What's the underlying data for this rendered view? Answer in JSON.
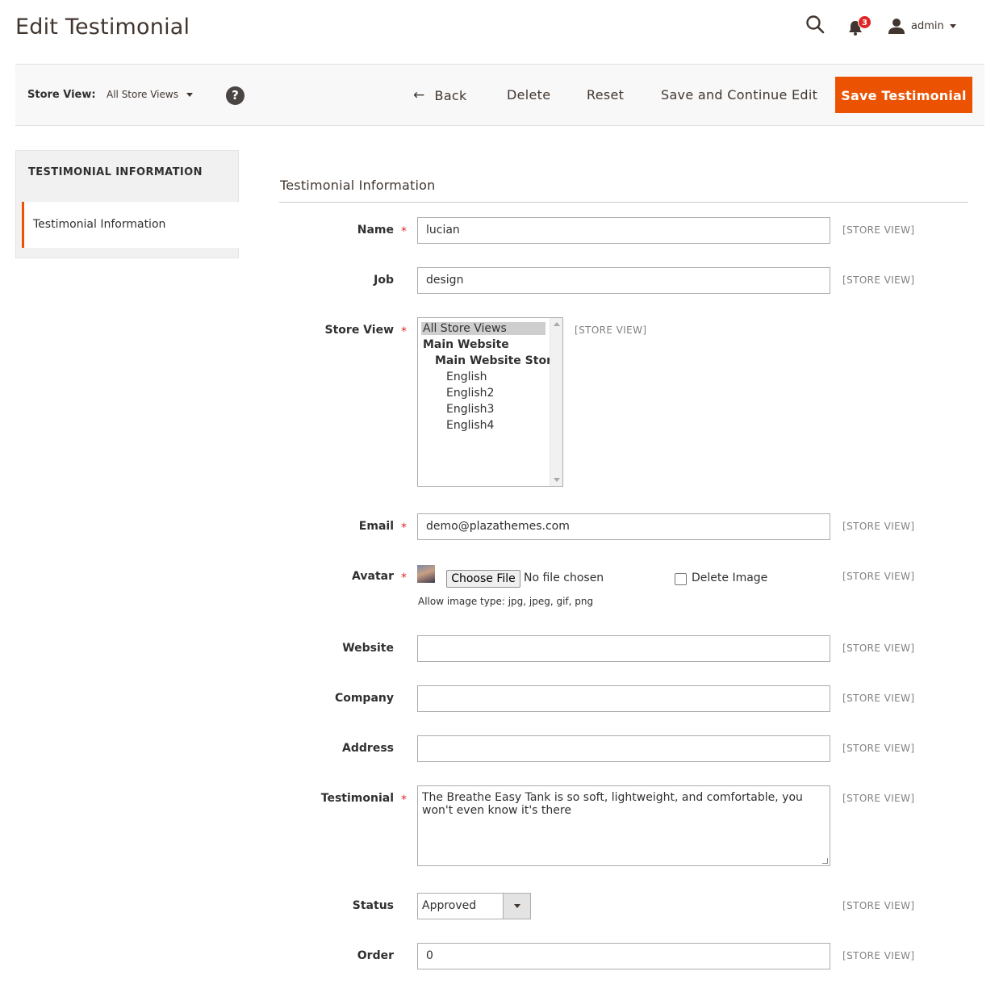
{
  "page": {
    "title": "Edit Testimonial"
  },
  "header": {
    "search_icon": "search-icon",
    "notifications": {
      "icon": "bell-icon",
      "count": "3"
    },
    "user": {
      "icon": "user-icon",
      "name": "admin"
    }
  },
  "toolbar": {
    "store_view_label": "Store View:",
    "store_view_value": "All Store Views",
    "help_icon": "?",
    "back_label": "Back",
    "delete_label": "Delete",
    "reset_label": "Reset",
    "save_continue_label": "Save and Continue Edit",
    "save_label": "Save Testimonial"
  },
  "sidebar": {
    "title": "TESTIMONIAL INFORMATION",
    "items": [
      {
        "label": "Testimonial Information",
        "active": true
      }
    ]
  },
  "form": {
    "section_title": "Testimonial Information",
    "scope_label": "[STORE VIEW]",
    "name": {
      "label": "Name",
      "value": "lucian",
      "required": true
    },
    "job": {
      "label": "Job",
      "value": "design"
    },
    "store_view": {
      "label": "Store View",
      "required": true,
      "options": [
        "All Store Views",
        "Main Website",
        "Main Website Store",
        "English",
        "English2",
        "English3",
        "English4"
      ],
      "selected": "All Store Views"
    },
    "email": {
      "label": "Email",
      "value": "demo@plazathemes.com",
      "required": true
    },
    "avatar": {
      "label": "Avatar",
      "required": true,
      "choose_file_label": "Choose File",
      "file_status": "No file chosen",
      "delete_label": "Delete Image",
      "note": "Allow image type: jpg, jpeg, gif, png"
    },
    "website": {
      "label": "Website",
      "value": ""
    },
    "company": {
      "label": "Company",
      "value": ""
    },
    "address": {
      "label": "Address",
      "value": ""
    },
    "testimonial": {
      "label": "Testimonial",
      "required": true,
      "value": "The Breathe Easy Tank is so soft, lightweight, and comfortable, you won't even know it's there"
    },
    "status": {
      "label": "Status",
      "value": "Approved"
    },
    "order": {
      "label": "Order",
      "value": "0"
    }
  },
  "colors": {
    "accent": "#eb5202",
    "badge": "#e22626"
  }
}
